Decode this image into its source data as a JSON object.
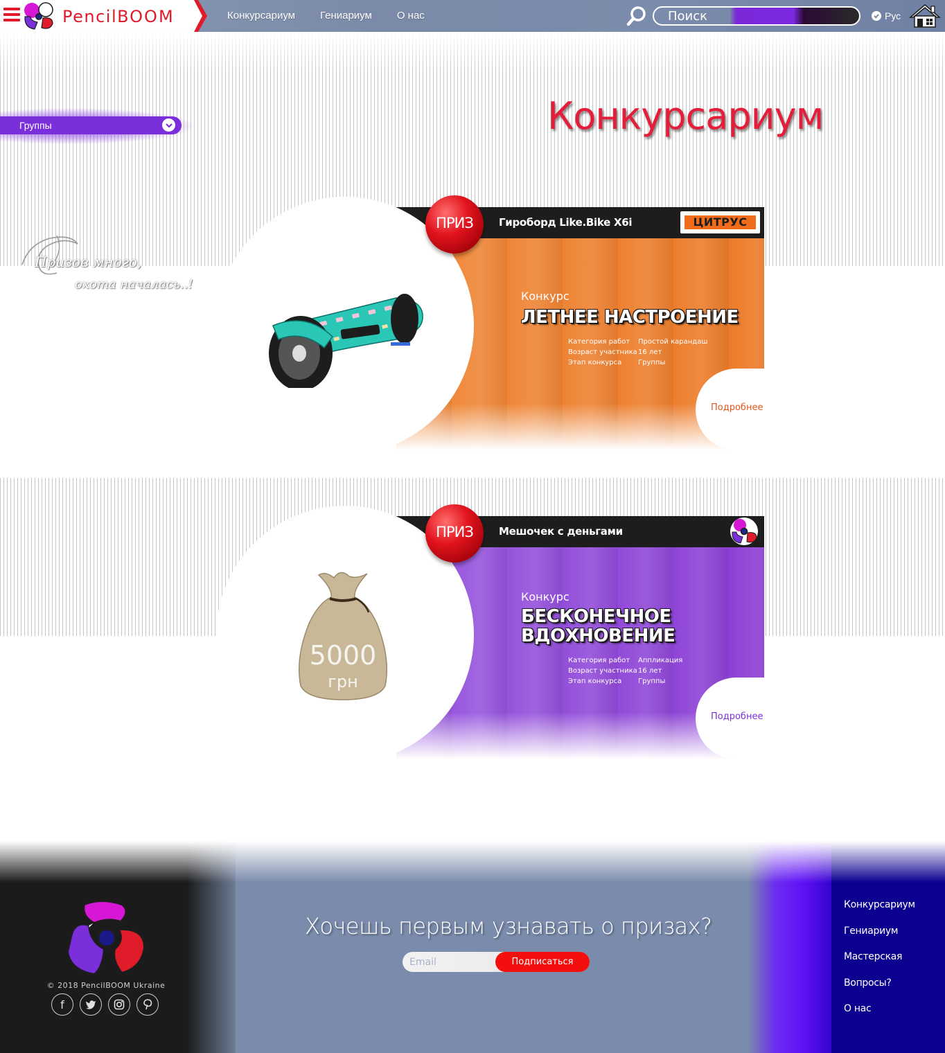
{
  "header": {
    "brand_prefix": "Pencil",
    "brand_suffix": "BOOM",
    "nav": [
      "Конкурсариум",
      "Гениариум",
      "О нас"
    ],
    "search_placeholder": "Поиск",
    "language": "Рус",
    "accent_color": "#e01b2a"
  },
  "sidebar": {
    "groups_label": "Группы"
  },
  "page": {
    "title": "Конкурсариум",
    "slogan_line1": "Призов много,",
    "slogan_line2": "охота началась..!"
  },
  "contests": [
    {
      "badge": "ПРИЗ",
      "prize_name": "Гироборд Like.Bike X6i",
      "sponsor": "ЦИТРУС",
      "label": "Конкурс",
      "name": "ЛЕТНЕЕ НАСТРОЕНИЕ",
      "details": [
        {
          "key": "Категория работ",
          "value": "Простой карандаш"
        },
        {
          "key": "Возраст участника",
          "value": "16 лет"
        },
        {
          "key": "Этап конкурса",
          "value": "Группы"
        }
      ],
      "more": "Подробнее",
      "color": "#ec7a27"
    },
    {
      "badge": "ПРИЗ",
      "prize_name": "Мешочек с деньгами",
      "label": "Конкурс",
      "name_line1": "БЕСКОНЕЧНОЕ",
      "name_line2": "ВДОХНОВЕНИЕ",
      "bag_amount": "5000",
      "bag_currency": "грн",
      "details": [
        {
          "key": "Категория работ",
          "value": "Аппликация"
        },
        {
          "key": "Возраст участника",
          "value": "16 лет"
        },
        {
          "key": "Этап конкурса",
          "value": "Группы"
        }
      ],
      "more": "Подробнее",
      "color": "#8b3dd4"
    }
  ],
  "footer": {
    "copyright": "© 2018 PencilBOOM Ukraine",
    "socials": [
      "facebook-icon",
      "twitter-icon",
      "instagram-icon",
      "pinterest-icon"
    ],
    "newsletter_title": "Хочешь первым узнавать о призах?",
    "email_placeholder": "Email",
    "subscribe_label": "Подписаться",
    "nav": [
      "Конкурсариум",
      "Гениариум",
      "Мастерская",
      "Вопросы?",
      "О нас"
    ]
  }
}
